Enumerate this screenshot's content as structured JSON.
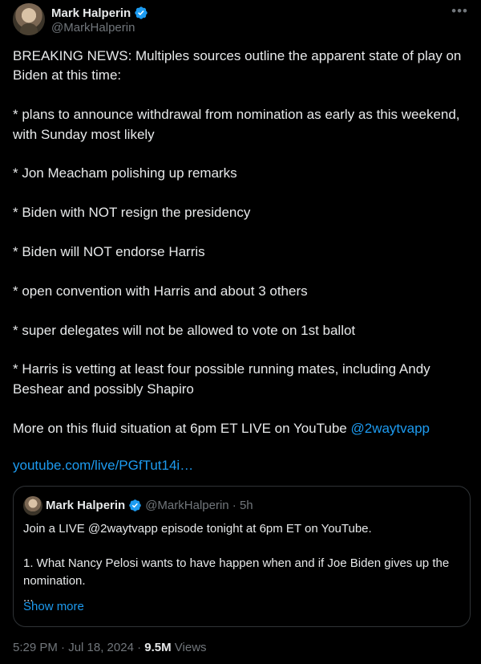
{
  "author": {
    "display_name": "Mark Halperin",
    "handle": "@MarkHalperin"
  },
  "more_icon": "•••",
  "tweet": {
    "paragraphs": [
      "BREAKING NEWS: Multiples sources outline the apparent state of play on Biden at this time:",
      "* plans to announce withdrawal from nomination as early as this weekend, with Sunday most likely",
      "* Jon Meacham polishing up remarks",
      "* Biden with NOT resign the presidency",
      "* Biden will NOT endorse Harris",
      "* open convention with Harris and about 3 others",
      "* super delegates will not be allowed to vote on 1st ballot",
      "* Harris is vetting at least four possible running mates, including Andy Beshear and possibly Shapiro"
    ],
    "last_line_prefix": "More on this fluid situation at 6pm ET LIVE on YouTube ",
    "mention": "@2waytvapp",
    "url": "youtube.com/live/PGfTut14i…"
  },
  "quote": {
    "display_name": "Mark Halperin",
    "handle_time": "@MarkHalperin · 5h",
    "line1": "Join a LIVE @2waytvapp episode tonight at 6pm ET on YouTube.",
    "line2": "1. What Nancy Pelosi wants to have happen when and if Joe Biden gives up the nomination.",
    "line3": "...",
    "show_more": "Show more"
  },
  "footer": {
    "timestamp": "5:29 PM · Jul 18, 2024 · ",
    "views_count": "9.5M",
    "views_label": " Views"
  },
  "colors": {
    "background": "#000000",
    "text": "#e7e9ea",
    "secondary": "#71767b",
    "link": "#1d9bf0",
    "border": "#2f3336"
  }
}
